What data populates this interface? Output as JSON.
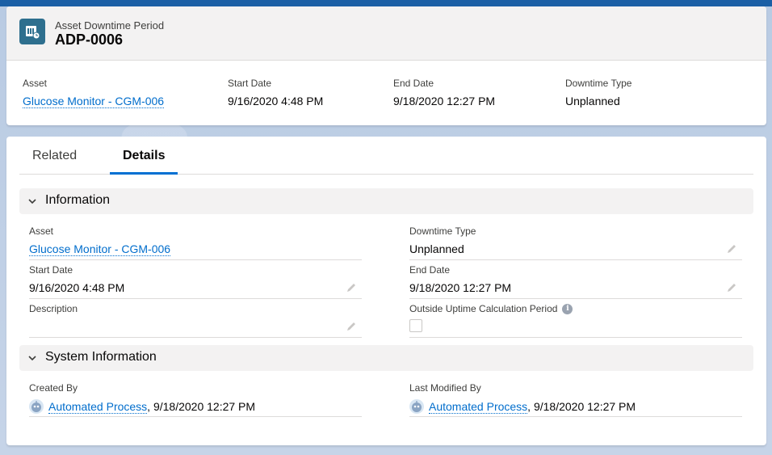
{
  "header": {
    "object_label": "Asset Downtime Period",
    "record_name": "ADP-0006",
    "icon": "asset-downtime-icon",
    "highlights": [
      {
        "label": "Asset",
        "value": "Glucose Monitor - CGM-006",
        "link": true
      },
      {
        "label": "Start Date",
        "value": "9/16/2020 4:48 PM"
      },
      {
        "label": "End Date",
        "value": "9/18/2020 12:27 PM"
      },
      {
        "label": "Downtime Type",
        "value": "Unplanned"
      }
    ]
  },
  "tabs": [
    {
      "label": "Related",
      "active": false
    },
    {
      "label": "Details",
      "active": true
    }
  ],
  "sections": {
    "information": {
      "title": "Information",
      "fields": {
        "asset": {
          "label": "Asset",
          "value": "Glucose Monitor - CGM-006"
        },
        "downtime_type": {
          "label": "Downtime Type",
          "value": "Unplanned"
        },
        "start_date": {
          "label": "Start Date",
          "value": "9/16/2020 4:48 PM"
        },
        "end_date": {
          "label": "End Date",
          "value": "9/18/2020 12:27 PM"
        },
        "description": {
          "label": "Description",
          "value": ""
        },
        "outside_uptime": {
          "label": "Outside Uptime Calculation Period",
          "checked": false
        }
      }
    },
    "system": {
      "title": "System Information",
      "fields": {
        "created_by": {
          "label": "Created By",
          "user": "Automated Process",
          "date": ", 9/18/2020 12:27 PM"
        },
        "last_modified_by": {
          "label": "Last Modified By",
          "user": "Automated Process",
          "date": ", 9/18/2020 12:27 PM"
        }
      }
    }
  },
  "colors": {
    "link": "#006dcc",
    "accent_tab": "#0070d2",
    "icon_bg": "#2e6f8e"
  }
}
